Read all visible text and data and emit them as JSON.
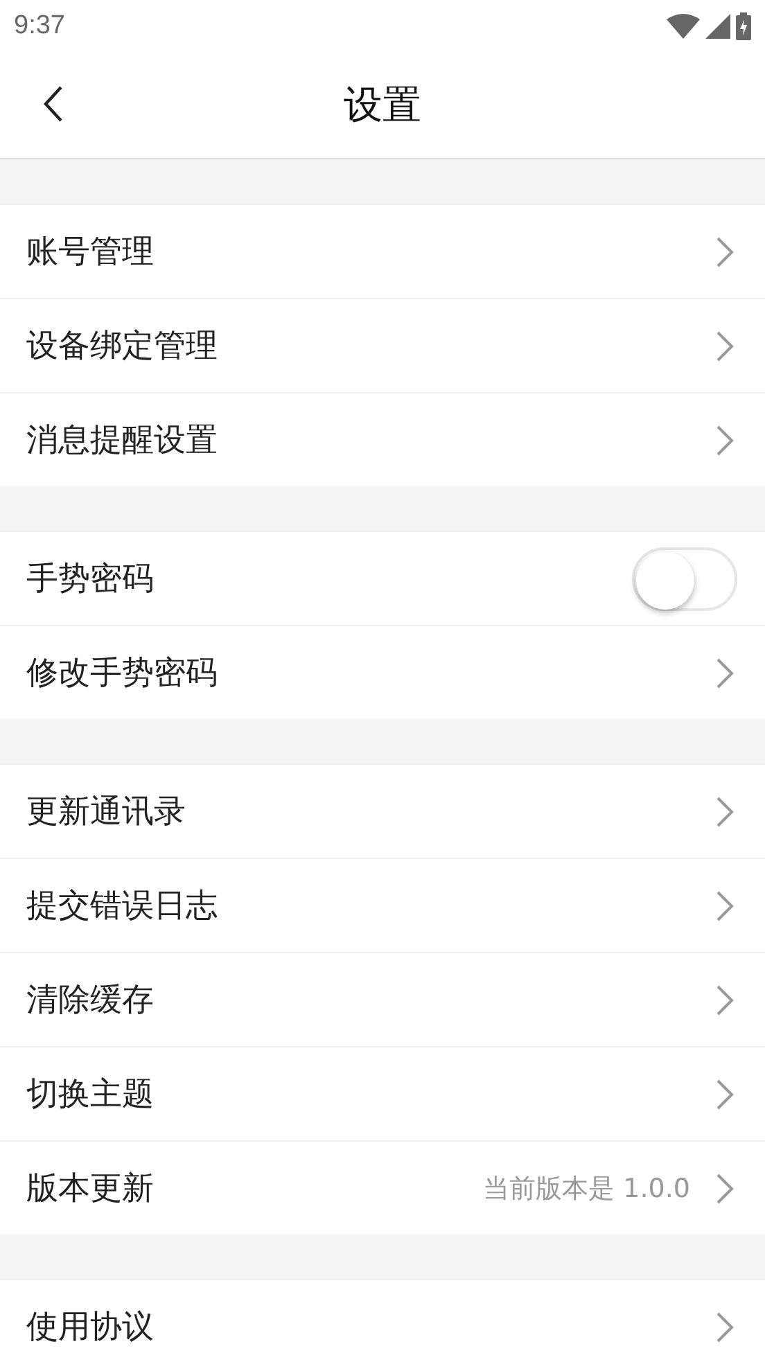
{
  "status_bar": {
    "time": "9:37"
  },
  "header": {
    "title": "设置"
  },
  "groups": [
    {
      "items": [
        {
          "kind": "link",
          "label": "账号管理"
        },
        {
          "kind": "link",
          "label": "设备绑定管理"
        },
        {
          "kind": "link",
          "label": "消息提醒设置"
        }
      ]
    },
    {
      "items": [
        {
          "kind": "toggle",
          "label": "手势密码",
          "on": false
        },
        {
          "kind": "link",
          "label": "修改手势密码"
        }
      ]
    },
    {
      "items": [
        {
          "kind": "link",
          "label": "更新通讯录"
        },
        {
          "kind": "link",
          "label": "提交错误日志"
        },
        {
          "kind": "link",
          "label": "清除缓存"
        },
        {
          "kind": "link",
          "label": "切换主题"
        },
        {
          "kind": "link",
          "label": "版本更新",
          "value": "当前版本是 1.0.0"
        }
      ]
    },
    {
      "items": [
        {
          "kind": "link",
          "label": "使用协议"
        }
      ]
    }
  ]
}
